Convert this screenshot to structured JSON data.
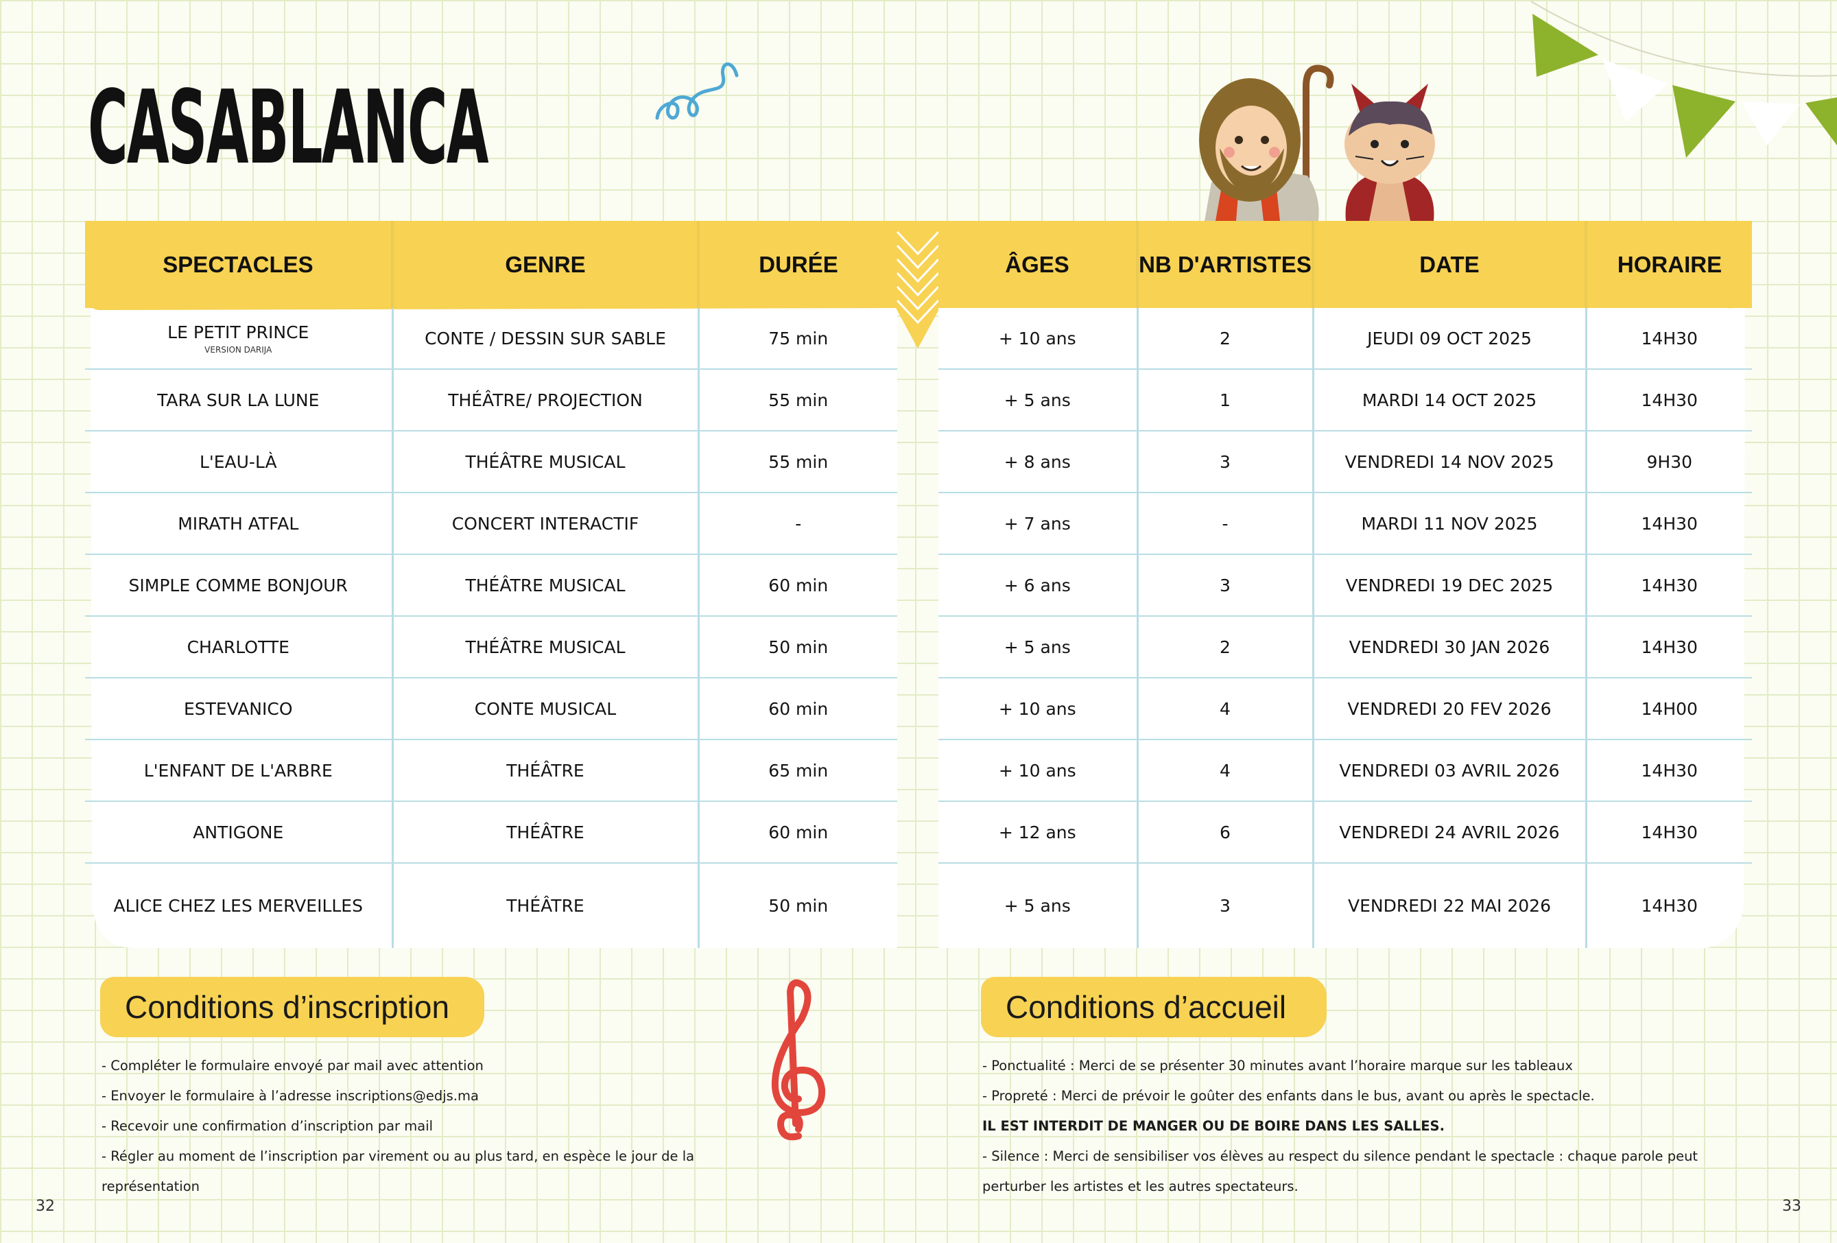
{
  "title": "CASABLANCA",
  "left_table": {
    "headers": [
      "SPECTACLES",
      "GENRE",
      "DURÉE"
    ],
    "rows": [
      {
        "title": "LE PETIT PRINCE",
        "subtitle": "VERSION DARIJA",
        "genre": "CONTE / DESSIN SUR SABLE",
        "duree": "75 min"
      },
      {
        "title": "TARA SUR LA LUNE",
        "subtitle": "",
        "genre": "THÉÂTRE/ PROJECTION",
        "duree": "55 min"
      },
      {
        "title": "L'EAU-LÀ",
        "subtitle": "",
        "genre": "THÉÂTRE MUSICAL",
        "duree": "55 min"
      },
      {
        "title": "MIRATH ATFAL",
        "subtitle": "",
        "genre": "CONCERT INTERACTIF",
        "duree": "-"
      },
      {
        "title": "SIMPLE COMME BONJOUR",
        "subtitle": "",
        "genre": "THÉÂTRE MUSICAL",
        "duree": "60 min"
      },
      {
        "title": "CHARLOTTE",
        "subtitle": "",
        "genre": "THÉÂTRE MUSICAL",
        "duree": "50 min"
      },
      {
        "title": "ESTEVANICO",
        "subtitle": "",
        "genre": "CONTE MUSICAL",
        "duree": "60 min"
      },
      {
        "title": "L'ENFANT DE L'ARBRE",
        "subtitle": "",
        "genre": "THÉÂTRE",
        "duree": "65 min"
      },
      {
        "title": "ANTIGONE",
        "subtitle": "",
        "genre": "THÉÂTRE",
        "duree": "60 min"
      },
      {
        "title": "ALICE CHEZ LES MERVEILLES",
        "subtitle": "",
        "genre": "THÉÂTRE",
        "duree": "50 min"
      }
    ]
  },
  "right_table": {
    "headers": [
      "ÂGES",
      "NB D'ARTISTES",
      "DATE",
      "HORAIRE"
    ],
    "rows": [
      {
        "ages": "+ 10 ans",
        "nb": "2",
        "date": "JEUDI 09 OCT 2025",
        "horaire": "14H30"
      },
      {
        "ages": "+ 5 ans",
        "nb": "1",
        "date": "MARDI 14 OCT 2025",
        "horaire": "14H30"
      },
      {
        "ages": "+ 8 ans",
        "nb": "3",
        "date": "VENDREDI 14 NOV 2025",
        "horaire": "9H30"
      },
      {
        "ages": "+ 7 ans",
        "nb": "-",
        "date": "MARDI 11 NOV 2025",
        "horaire": "14H30"
      },
      {
        "ages": "+ 6 ans",
        "nb": "3",
        "date": "VENDREDI 19 DEC 2025",
        "horaire": "14H30"
      },
      {
        "ages": "+ 5 ans",
        "nb": "2",
        "date": "VENDREDI 30 JAN 2026",
        "horaire": "14H30"
      },
      {
        "ages": "+ 10 ans",
        "nb": "4",
        "date": "VENDREDI 20 FEV 2026",
        "horaire": "14H00"
      },
      {
        "ages": "+ 10 ans",
        "nb": "4",
        "date": "VENDREDI 03 AVRIL 2026",
        "horaire": "14H30"
      },
      {
        "ages": "+ 12 ans",
        "nb": "6",
        "date": "VENDREDI 24 AVRIL 2026",
        "horaire": "14H30"
      },
      {
        "ages": "+ 5 ans",
        "nb": "3",
        "date": "VENDREDI 22 MAI 2026",
        "horaire": "14H30"
      }
    ]
  },
  "inscription": {
    "title": "Conditions d’inscription",
    "items": [
      "- Compléter le formulaire envoyé par mail avec attention",
      "- Envoyer le formulaire à l’adresse inscriptions@edjs.ma",
      "- Recevoir une confirmation d’inscription par mail",
      "- Régler au moment de l’inscription par virement ou au plus tard,  en espèce le jour de la représentation"
    ]
  },
  "accueil": {
    "title": "Conditions d’accueil",
    "items": [
      "- Ponctualité : Merci de se présenter 30 minutes avant l’horaire marque sur les tableaux",
      "- Propreté : Merci de prévoir le goûter des enfants dans le bus, avant ou après le spectacle.",
      "IL EST INTERDIT DE MANGER OU DE BOIRE DANS LES SALLES.",
      "- Silence : Merci de sensibiliser vos élèves au respect du silence pendant le spectacle : chaque parole peut perturber les artistes et les autres spectateurs."
    ]
  },
  "page_numbers": {
    "left": "32",
    "right": "33"
  },
  "colors": {
    "header_yellow": "#f7d253",
    "grid_green": "#e2ecc6",
    "row_line": "#b9dde4",
    "bunting_green": "#8db22c",
    "clef_red": "#e2453c"
  }
}
